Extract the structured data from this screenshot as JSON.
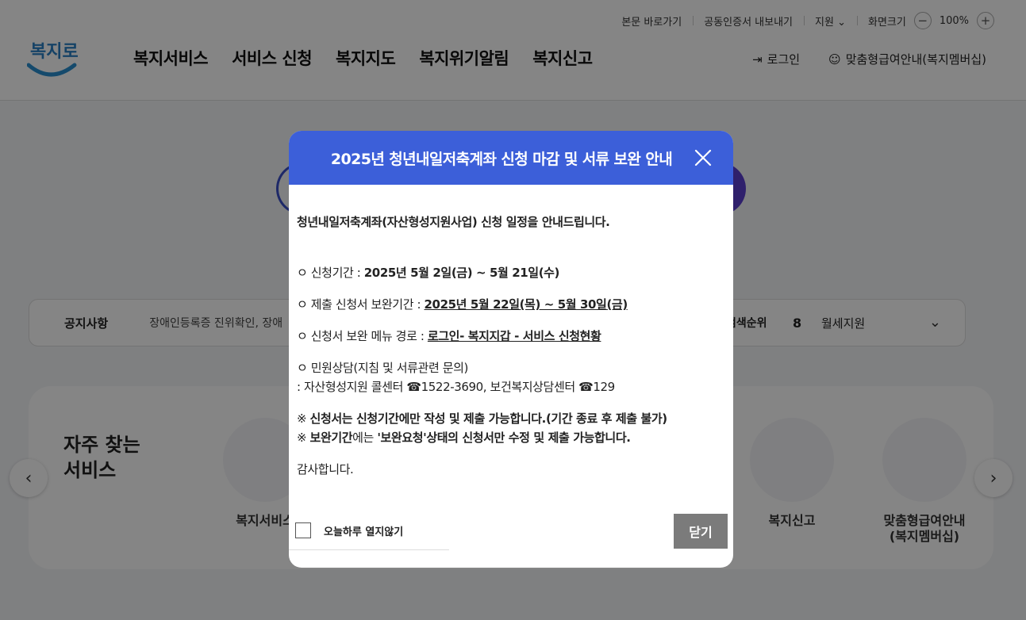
{
  "utility": {
    "skip_to_content": "본문 바로가기",
    "cert_export": "공동인증서 내보내기",
    "support": "지원",
    "zoom_label": "화면크기",
    "zoom_value": "100%"
  },
  "logo": {
    "text": "복지로"
  },
  "gnb": [
    "복지서비스",
    "서비스 신청",
    "복지지도",
    "복지위기알림",
    "복지신고"
  ],
  "header_right": {
    "login": "로그인",
    "membership": "맞춤형급여안내(복지멤버십)"
  },
  "notice": {
    "label": "공지사항",
    "text": "장애인등록증 진위확인, 장애",
    "rank_label": "검색순위",
    "rank_num": "8",
    "rank_item": "월세지원"
  },
  "services": {
    "title_line1": "자주 찾는",
    "title_line2": "서비스",
    "items": [
      {
        "label": "복지서비스"
      },
      {
        "label": "복지신고"
      },
      {
        "label": "맞춤형급여안내\n(복지멤버십)"
      }
    ]
  },
  "modal": {
    "title": "2025년 청년내일저축계좌 신청 마감 및 서류 보완 안내",
    "intro": "청년내일저축계좌(자산형성지원사업) 신청 일정을 안내드립니다.",
    "period_label": "ㅇ 신청기간 : ",
    "period_value": "2025년 5월 2일(금) ~ 5월 21일(수)",
    "supplement_label": "ㅇ 제출 신청서 보완기간 : ",
    "supplement_value": "2025년 5월 22일(목) ~ 5월 30일(금)",
    "menu_label": "ㅇ 신청서 보완 메뉴 경로 : ",
    "menu_value": " 로그인- 복지지갑 - 서비스 신청현황",
    "consult_line1": "ㅇ 민원상담(지침 및 서류관련 문의)",
    "consult_line2": " : 자산형성지원 콜센터 ☎1522-3690, 보건복지상담센터 ☎129",
    "note1_prefix": "※ ",
    "note1_bold": "신청서",
    "note1_rest": "는 신청기간에만 작성 및 제출 가능합니다.(기간 종료 후 제출 불가)",
    "note2_prefix": "※ ",
    "note2_bold": "보완기간",
    "note2_mid": "에는 ",
    "note2_rest": "'보완요청'상태의 신청서만 수정 및 제출 가능합니다.",
    "thanks": "감사합니다.",
    "checkbox_label": "오늘하루 열지않기",
    "close_button": "닫기"
  },
  "colors": {
    "modal_header": "#3c5fd9",
    "close_button": "#7b7b7b"
  }
}
